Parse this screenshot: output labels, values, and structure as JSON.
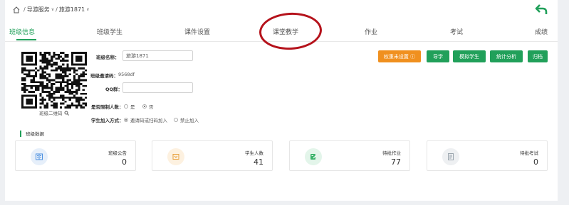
{
  "breadcrumb": {
    "section": "导游服务",
    "current": "旅游1871"
  },
  "tabs": [
    {
      "label": "班级信息",
      "active": true
    },
    {
      "label": "班级学生"
    },
    {
      "label": "课件设置"
    },
    {
      "label": "课堂教学"
    },
    {
      "label": "作业"
    },
    {
      "label": "考试"
    },
    {
      "label": "成绩"
    }
  ],
  "qr": {
    "label": "班级二维码"
  },
  "form": {
    "class_name_label": "班级名称：",
    "class_name_value": "旅游1871",
    "invite_label": "班级邀请码：",
    "invite_value": "9568df",
    "qq_label": "QQ群：",
    "qq_value": "",
    "limit_label": "是否限制人数：",
    "limit_options": [
      "是",
      "否"
    ],
    "limit_selected": "否",
    "join_label": "学生加入方式：",
    "join_options": [
      "邀请码或扫码加入",
      "禁止加入"
    ],
    "join_selected": "邀请码或扫码加入"
  },
  "actions": [
    {
      "label": "权重未设置 ⓘ",
      "color": "#f0901f"
    },
    {
      "label": "导学",
      "color": "#21a05a"
    },
    {
      "label": "模拟学生",
      "color": "#21a05a"
    },
    {
      "label": "统计分析",
      "color": "#21a05a"
    },
    {
      "label": "归档",
      "color": "#21a05a"
    }
  ],
  "section_title": "班级数据",
  "stats": [
    {
      "name": "班级公告",
      "value": "0",
      "icon": "notice-icon"
    },
    {
      "name": "学生人数",
      "value": "41",
      "icon": "students-icon"
    },
    {
      "name": "待批作业",
      "value": "77",
      "icon": "homework-icon"
    },
    {
      "name": "待批考试",
      "value": "0",
      "icon": "exam-icon"
    }
  ],
  "colors": {
    "accent": "#21a05a",
    "warning": "#f0901f",
    "annotation": "#b5121b"
  }
}
